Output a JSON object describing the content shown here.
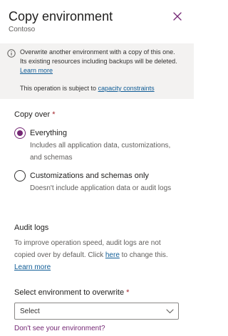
{
  "panel": {
    "title": "Copy environment",
    "subtitle": "Contoso",
    "close_icon": "close-icon"
  },
  "info": {
    "icon": "info-icon",
    "message": "Overwrite another environment with a copy of this one. Its existing resources including backups will be deleted.",
    "learn_more": "Learn more",
    "note_prefix": "This operation is subject to",
    "note_link": "capacity constraints"
  },
  "copy_over": {
    "label": "Copy over",
    "required": "*",
    "options": [
      {
        "label": "Everything",
        "description": "Includes all application data, customizations, and schemas",
        "selected": true
      },
      {
        "label": "Customizations and schemas only",
        "description": "Doesn't include application data or audit logs",
        "selected": false
      }
    ]
  },
  "audit_logs": {
    "heading": "Audit logs",
    "text_part1": "To improve operation speed, audit logs are not copied over by default. Click",
    "here_link": "here",
    "text_part2": "to change this.",
    "learn_more": "Learn more"
  },
  "target": {
    "label": "Select environment to overwrite",
    "required": "*",
    "select_value": "Select",
    "chevron_icon": "chevron-down-icon",
    "help_link": "Don't see your environment?"
  },
  "colors": {
    "accent": "#742774",
    "link": "#0f5c96",
    "required": "#a4262c",
    "info_background": "#f3f2f1"
  }
}
